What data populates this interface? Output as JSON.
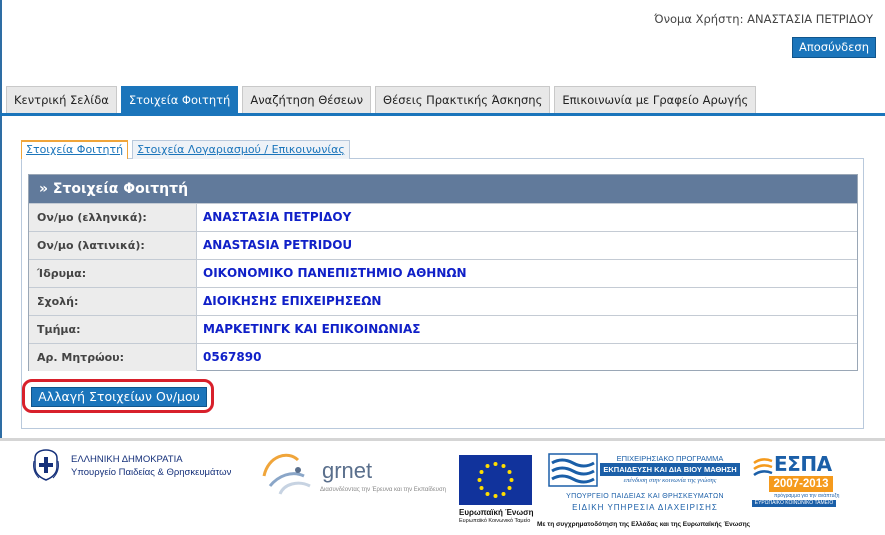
{
  "header": {
    "user_label": "Όνομα Χρήστη:",
    "user_name": "ΑΝΑΣΤΑΣΙΑ ΠΕΤΡΙΔΟΥ",
    "logout_label": "Αποσύνδεση"
  },
  "nav": {
    "tabs": [
      {
        "label": "Κεντρική Σελίδα",
        "active": false
      },
      {
        "label": "Στοιχεία Φοιτητή",
        "active": true
      },
      {
        "label": "Αναζήτηση Θέσεων",
        "active": false
      },
      {
        "label": "Θέσεις Πρακτικής Άσκησης",
        "active": false
      },
      {
        "label": "Επικοινωνία με Γραφείο Αρωγής",
        "active": false
      }
    ]
  },
  "subtabs": [
    {
      "label": "Στοιχεία Φοιτητή",
      "active": true
    },
    {
      "label": "Στοιχεία Λογαριασμού / Επικοινωνίας",
      "active": false
    }
  ],
  "student": {
    "heading": "» Στοιχεία Φοιτητή",
    "rows": [
      {
        "label": "Ον/μο (ελληνικά):",
        "value": "ΑΝΑΣΤΑΣΙΑ ΠΕΤΡΙΔΟΥ"
      },
      {
        "label": "Ον/μο (λατινικά):",
        "value": "ANASTASIA PETRIDOU"
      },
      {
        "label": "Ίδρυμα:",
        "value": "ΟΙΚΟΝΟΜΙΚΟ ΠΑΝΕΠΙΣΤΗΜΙΟ ΑΘΗΝΩΝ"
      },
      {
        "label": "Σχολή:",
        "value": "ΔΙΟΙΚΗΣΗΣ ΕΠΙΧΕΙΡΗΣΕΩΝ"
      },
      {
        "label": "Τμήμα:",
        "value": "ΜΑΡΚΕΤΙΝΓΚ ΚΑΙ ΕΠΙΚΟΙΝΩΝΙΑΣ"
      },
      {
        "label": "Αρ. Μητρώου:",
        "value": "0567890"
      }
    ],
    "change_button_label": "Αλλαγή Στοιχείων Ον/μου"
  },
  "footer": {
    "republic_line1": "ΕΛΛΗΝΙΚΗ ΔΗΜΟΚΡΑΤΙΑ",
    "republic_line2": "Υπουργείο Παιδείας & Θρησκευμάτων",
    "grnet_name": "grnet",
    "grnet_tagline": "Διασυνδέοντας την Έρευνα και την Εκπαίδευση",
    "eu_line1": "Ευρωπαϊκή Ένωση",
    "eu_line2": "Ευρωπαϊκό Κοινωνικό Ταμείο",
    "epea_line1": "ΕΠΙΧΕΙΡΗΣΙΑΚΟ ΠΡΟΓΡΑΜΜΑ",
    "epea_line2": "ΕΚΠΑΙΔΕΥΣΗ ΚΑΙ ΔΙΑ ΒΙΟΥ ΜΑΘΗΣΗ",
    "epea_line3": "επένδυση στην κοινωνία της γνώσης",
    "ministry_line1": "ΥΠΟΥΡΓΕΙΟ ΠΑΙΔΕΙΑΣ ΚΑΙ ΘΡΗΣΚΕΥΜΑΤΩΝ",
    "ministry_line2": "ΕΙΔΙΚΗ ΥΠΗΡΕΣΙΑ ΔΙΑΧΕΙΡΙΣΗΣ",
    "cofinance": "Με τη συγχρηματοδότηση της Ελλάδας και της Ευρωπαϊκής Ένωσης",
    "espa_title": "ΕΣΠΑ",
    "espa_years": "2007-2013",
    "espa_motto": "πρόγραμμα για την ανάπτυξη",
    "espa_fund": "ΕΥΡΩΠΑΪΚΟ ΚΟΙΝΩΝΙΚΟ ΤΑΜΕΙΟ"
  }
}
